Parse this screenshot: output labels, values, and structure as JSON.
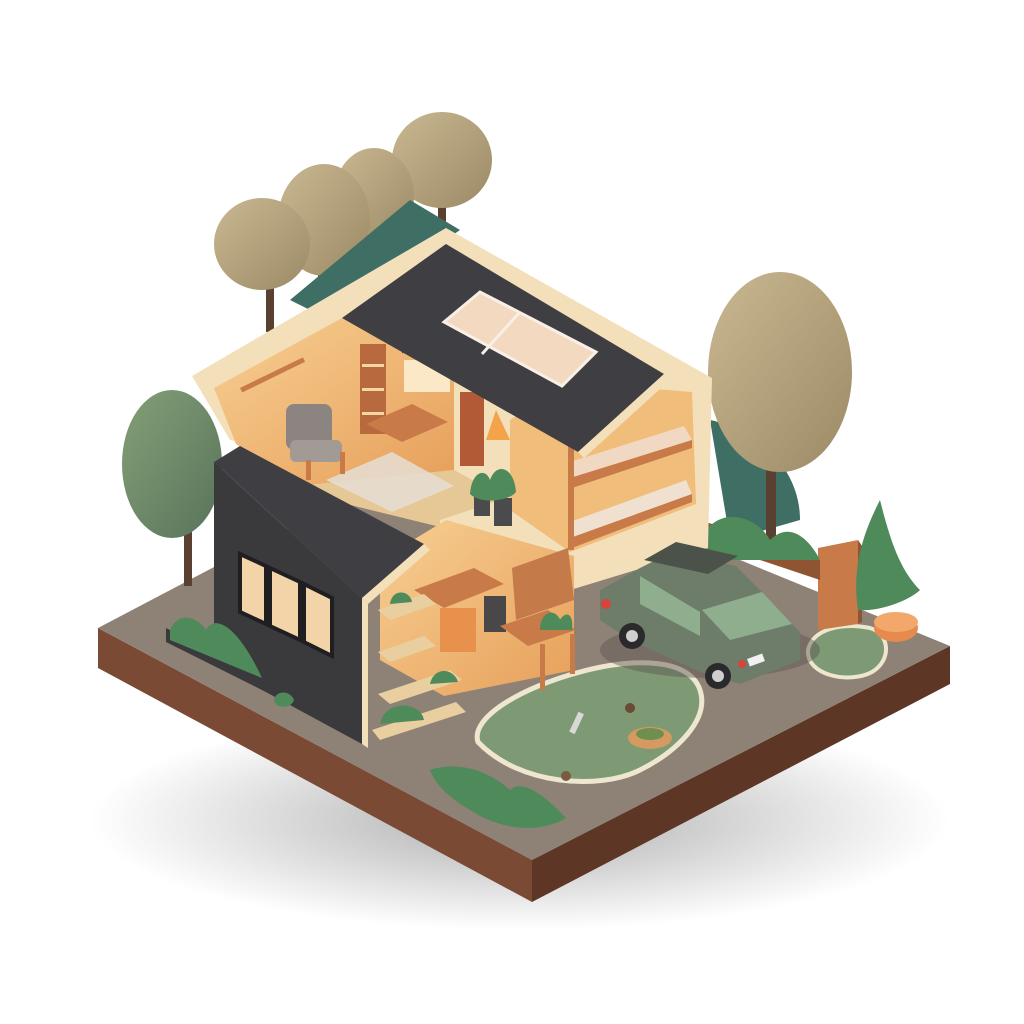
{
  "scene": {
    "subject": "isometric-house-cutaway",
    "colors": {
      "background": "#ffffff",
      "base_top": "#8e8276",
      "base_left": "#7a4a35",
      "base_right": "#5e3626",
      "lawn": "#7e9a74",
      "lawn_edge": "#efe6cf",
      "wall_dark": "#3a393c",
      "roof_dark": "#3f3e42",
      "wall_trim": "#f3dfba",
      "interior_warm": "#f1bd7a",
      "interior_floor": "#e6c796",
      "wood": "#c87b48",
      "tree_canopy": "#b7a47e",
      "tree_green": "#6f8c66",
      "tree_trunk": "#5a4030",
      "car_body": "#6e7c6a",
      "car_window": "#8fae8e",
      "plant_green": "#4f8a5a",
      "accent_orange": "#e68a4f"
    }
  }
}
